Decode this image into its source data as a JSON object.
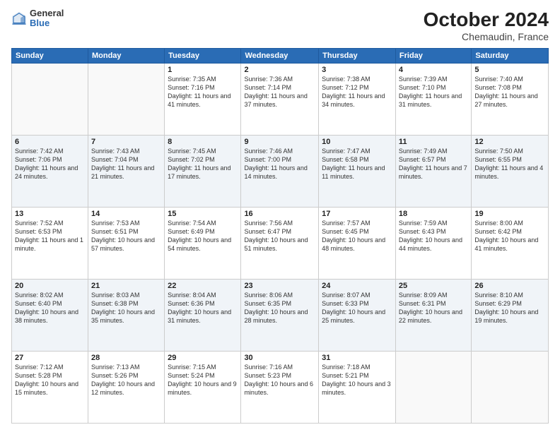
{
  "header": {
    "logo_general": "General",
    "logo_blue": "Blue",
    "month_title": "October 2024",
    "location": "Chemaudin, France"
  },
  "days_of_week": [
    "Sunday",
    "Monday",
    "Tuesday",
    "Wednesday",
    "Thursday",
    "Friday",
    "Saturday"
  ],
  "weeks": [
    [
      {
        "day": "",
        "info": ""
      },
      {
        "day": "",
        "info": ""
      },
      {
        "day": "1",
        "info": "Sunrise: 7:35 AM\nSunset: 7:16 PM\nDaylight: 11 hours and 41 minutes."
      },
      {
        "day": "2",
        "info": "Sunrise: 7:36 AM\nSunset: 7:14 PM\nDaylight: 11 hours and 37 minutes."
      },
      {
        "day": "3",
        "info": "Sunrise: 7:38 AM\nSunset: 7:12 PM\nDaylight: 11 hours and 34 minutes."
      },
      {
        "day": "4",
        "info": "Sunrise: 7:39 AM\nSunset: 7:10 PM\nDaylight: 11 hours and 31 minutes."
      },
      {
        "day": "5",
        "info": "Sunrise: 7:40 AM\nSunset: 7:08 PM\nDaylight: 11 hours and 27 minutes."
      }
    ],
    [
      {
        "day": "6",
        "info": "Sunrise: 7:42 AM\nSunset: 7:06 PM\nDaylight: 11 hours and 24 minutes."
      },
      {
        "day": "7",
        "info": "Sunrise: 7:43 AM\nSunset: 7:04 PM\nDaylight: 11 hours and 21 minutes."
      },
      {
        "day": "8",
        "info": "Sunrise: 7:45 AM\nSunset: 7:02 PM\nDaylight: 11 hours and 17 minutes."
      },
      {
        "day": "9",
        "info": "Sunrise: 7:46 AM\nSunset: 7:00 PM\nDaylight: 11 hours and 14 minutes."
      },
      {
        "day": "10",
        "info": "Sunrise: 7:47 AM\nSunset: 6:58 PM\nDaylight: 11 hours and 11 minutes."
      },
      {
        "day": "11",
        "info": "Sunrise: 7:49 AM\nSunset: 6:57 PM\nDaylight: 11 hours and 7 minutes."
      },
      {
        "day": "12",
        "info": "Sunrise: 7:50 AM\nSunset: 6:55 PM\nDaylight: 11 hours and 4 minutes."
      }
    ],
    [
      {
        "day": "13",
        "info": "Sunrise: 7:52 AM\nSunset: 6:53 PM\nDaylight: 11 hours and 1 minute."
      },
      {
        "day": "14",
        "info": "Sunrise: 7:53 AM\nSunset: 6:51 PM\nDaylight: 10 hours and 57 minutes."
      },
      {
        "day": "15",
        "info": "Sunrise: 7:54 AM\nSunset: 6:49 PM\nDaylight: 10 hours and 54 minutes."
      },
      {
        "day": "16",
        "info": "Sunrise: 7:56 AM\nSunset: 6:47 PM\nDaylight: 10 hours and 51 minutes."
      },
      {
        "day": "17",
        "info": "Sunrise: 7:57 AM\nSunset: 6:45 PM\nDaylight: 10 hours and 48 minutes."
      },
      {
        "day": "18",
        "info": "Sunrise: 7:59 AM\nSunset: 6:43 PM\nDaylight: 10 hours and 44 minutes."
      },
      {
        "day": "19",
        "info": "Sunrise: 8:00 AM\nSunset: 6:42 PM\nDaylight: 10 hours and 41 minutes."
      }
    ],
    [
      {
        "day": "20",
        "info": "Sunrise: 8:02 AM\nSunset: 6:40 PM\nDaylight: 10 hours and 38 minutes."
      },
      {
        "day": "21",
        "info": "Sunrise: 8:03 AM\nSunset: 6:38 PM\nDaylight: 10 hours and 35 minutes."
      },
      {
        "day": "22",
        "info": "Sunrise: 8:04 AM\nSunset: 6:36 PM\nDaylight: 10 hours and 31 minutes."
      },
      {
        "day": "23",
        "info": "Sunrise: 8:06 AM\nSunset: 6:35 PM\nDaylight: 10 hours and 28 minutes."
      },
      {
        "day": "24",
        "info": "Sunrise: 8:07 AM\nSunset: 6:33 PM\nDaylight: 10 hours and 25 minutes."
      },
      {
        "day": "25",
        "info": "Sunrise: 8:09 AM\nSunset: 6:31 PM\nDaylight: 10 hours and 22 minutes."
      },
      {
        "day": "26",
        "info": "Sunrise: 8:10 AM\nSunset: 6:29 PM\nDaylight: 10 hours and 19 minutes."
      }
    ],
    [
      {
        "day": "27",
        "info": "Sunrise: 7:12 AM\nSunset: 5:28 PM\nDaylight: 10 hours and 15 minutes."
      },
      {
        "day": "28",
        "info": "Sunrise: 7:13 AM\nSunset: 5:26 PM\nDaylight: 10 hours and 12 minutes."
      },
      {
        "day": "29",
        "info": "Sunrise: 7:15 AM\nSunset: 5:24 PM\nDaylight: 10 hours and 9 minutes."
      },
      {
        "day": "30",
        "info": "Sunrise: 7:16 AM\nSunset: 5:23 PM\nDaylight: 10 hours and 6 minutes."
      },
      {
        "day": "31",
        "info": "Sunrise: 7:18 AM\nSunset: 5:21 PM\nDaylight: 10 hours and 3 minutes."
      },
      {
        "day": "",
        "info": ""
      },
      {
        "day": "",
        "info": ""
      }
    ]
  ]
}
